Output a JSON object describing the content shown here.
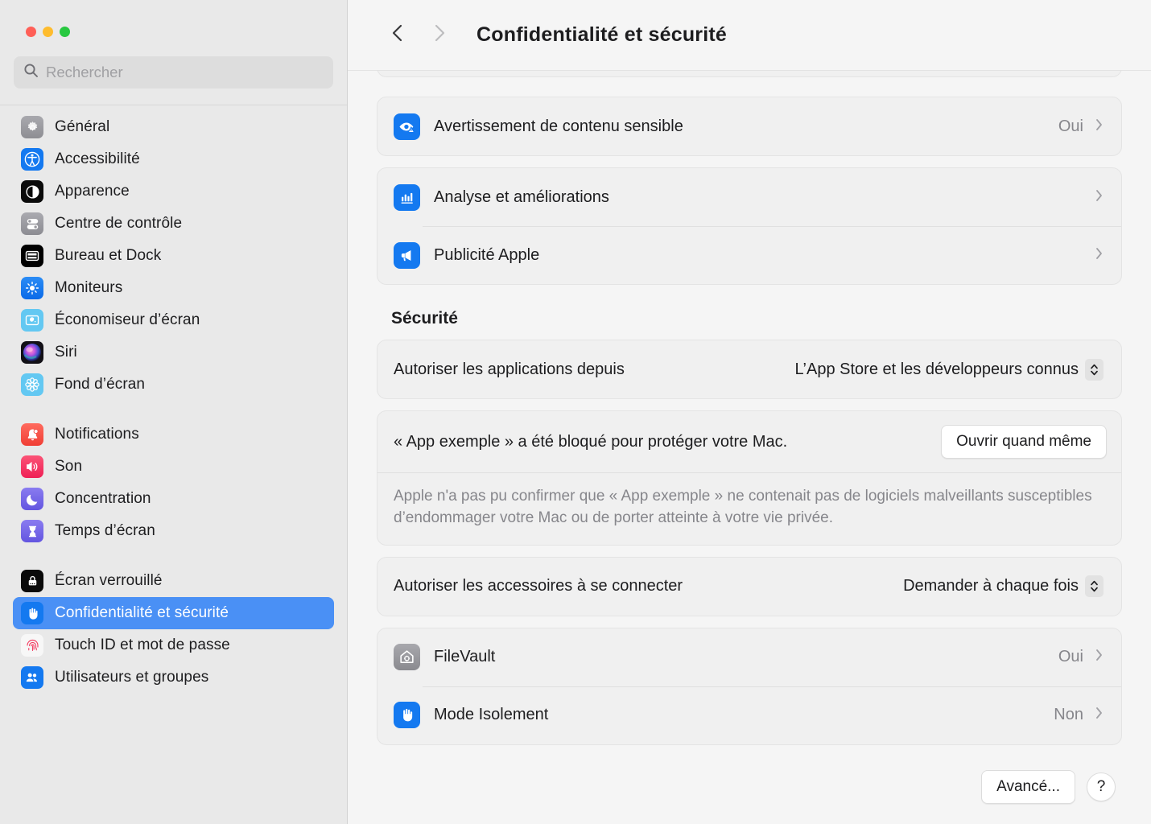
{
  "window": {
    "traffic_lights": [
      {
        "name": "close",
        "color": "#ff5f57"
      },
      {
        "name": "minimize",
        "color": "#febc2e"
      },
      {
        "name": "zoom",
        "color": "#28c840"
      }
    ]
  },
  "search": {
    "placeholder": "Rechercher",
    "value": "",
    "icon": "search-icon"
  },
  "sidebar": {
    "groups": [
      {
        "items": [
          {
            "label": "Général",
            "icon": "gear-icon",
            "selected": false
          },
          {
            "label": "Accessibilité",
            "icon": "accessibility-icon",
            "selected": false
          },
          {
            "label": "Apparence",
            "icon": "appearance-icon",
            "selected": false
          },
          {
            "label": "Centre de contrôle",
            "icon": "control-center-icon",
            "selected": false
          },
          {
            "label": "Bureau et Dock",
            "icon": "desktop-dock-icon",
            "selected": false
          },
          {
            "label": "Moniteurs",
            "icon": "displays-icon",
            "selected": false
          },
          {
            "label": "Économiseur d’écran",
            "icon": "screensaver-icon",
            "selected": false
          },
          {
            "label": "Siri",
            "icon": "siri-icon",
            "selected": false
          },
          {
            "label": "Fond d’écran",
            "icon": "wallpaper-icon",
            "selected": false
          }
        ]
      },
      {
        "items": [
          {
            "label": "Notifications",
            "icon": "notifications-icon",
            "selected": false
          },
          {
            "label": "Son",
            "icon": "sound-icon",
            "selected": false
          },
          {
            "label": "Concentration",
            "icon": "focus-icon",
            "selected": false
          },
          {
            "label": "Temps d’écran",
            "icon": "screen-time-icon",
            "selected": false
          }
        ]
      },
      {
        "items": [
          {
            "label": "Écran verrouillé",
            "icon": "lock-screen-icon",
            "selected": false
          },
          {
            "label": "Confidentialité et sécurité",
            "icon": "privacy-hand-icon",
            "selected": true
          },
          {
            "label": "Touch ID et mot de passe",
            "icon": "touch-id-icon",
            "selected": false
          },
          {
            "label": "Utilisateurs et groupes",
            "icon": "users-groups-icon",
            "selected": false
          }
        ]
      }
    ],
    "selection_color": "#4a90f5"
  },
  "header": {
    "title": "Confidentialité et sécurité",
    "back_icon": "chevron-left-icon",
    "forward_icon": "chevron-right-icon",
    "back_enabled": true,
    "forward_enabled": false
  },
  "main": {
    "privacy_rows": [
      {
        "label": "Avertissement de contenu sensible",
        "icon": "sensitive-content-eye-icon",
        "value": "Oui",
        "disclosure": "chevron-right-icon"
      }
    ],
    "analytics_rows": [
      {
        "label": "Analyse et améliorations",
        "icon": "analytics-bar-chart-icon",
        "value": "",
        "disclosure": "chevron-right-icon"
      },
      {
        "label": "Publicité Apple",
        "icon": "apple-advertising-megaphone-icon",
        "value": "",
        "disclosure": "chevron-right-icon"
      }
    ],
    "security_section_title": "Sécurité",
    "allow_apps": {
      "label": "Autoriser les applications depuis",
      "value": "L’App Store et les développeurs connus",
      "stepper_icon": "updown-chevrons-icon"
    },
    "blocked_app": {
      "title": "« App exemple » a été bloqué pour protéger votre Mac.",
      "button_label": "Ouvrir quand même",
      "description": "Apple n'a pas pu confirmer que « App exemple » ne contenait pas de logiciels malveillants susceptibles d’endommager votre Mac ou de porter atteinte à votre vie privée."
    },
    "accessories": {
      "label": "Autoriser les accessoires à se connecter",
      "value": "Demander à chaque fois",
      "stepper_icon": "updown-chevrons-icon"
    },
    "security_rows": [
      {
        "label": "FileVault",
        "icon": "filevault-house-icon",
        "value": "Oui",
        "disclosure": "chevron-right-icon"
      },
      {
        "label": "Mode Isolement",
        "icon": "lockdown-hand-icon",
        "value": "Non",
        "disclosure": "chevron-right-icon"
      }
    ]
  },
  "footer": {
    "advanced_label": "Avancé...",
    "help_label": "?",
    "help_icon": "question-mark-icon"
  }
}
